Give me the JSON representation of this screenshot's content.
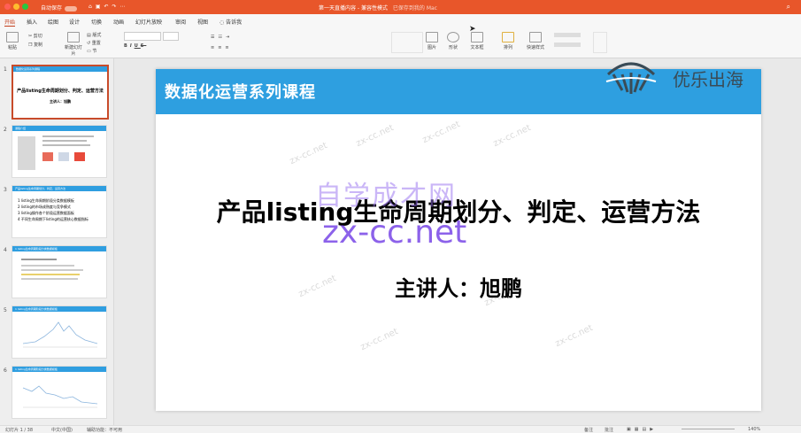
{
  "titlebar": {
    "autosave_label": "自动保存",
    "autosave_state": "off",
    "document_title": "第一天直播内容 - 兼容性模式",
    "document_subtitle": "已保存到我的 Mac"
  },
  "menu": {
    "tabs": [
      "开始",
      "插入",
      "绘图",
      "设计",
      "切换",
      "动画",
      "幻灯片放映",
      "审阅",
      "视图"
    ],
    "tell_me": "告诉我"
  },
  "ribbon": {
    "paste": "粘贴",
    "cut": "剪切",
    "copy": "复制",
    "new_slide": "新建幻灯片",
    "layout": "版式",
    "reset": "重置",
    "section": "节",
    "picture": "图片",
    "shape": "形状",
    "textbox": "文本框",
    "arrange": "排列",
    "quick_styles": "快速样式"
  },
  "slides_panel": {
    "thumbnails": [
      {
        "number": "1",
        "header": "数据化运营系列课程",
        "title": "产品listing生命周期划分、判定、运营方法",
        "speaker": "主讲人：旭鹏",
        "selected": true
      },
      {
        "number": "2",
        "header": "课程介绍",
        "selected": false
      },
      {
        "number": "3",
        "header": "产品listing生命周期划分、判定、运营方法",
        "lines": [
          "1 listing生命周期阶段分类数据模板",
          "2 listing的市场成熟度与竞争模式",
          "3 listing操作各个阶段运营数据面板",
          "4 不同生命周期下listing的运营核心数据指标"
        ],
        "selected": false
      },
      {
        "number": "4",
        "header": "1 listing生命周期阶段分类数据模板",
        "selected": false
      },
      {
        "number": "5",
        "header": "1 listing生命周期阶段分类数据模板",
        "selected": false
      },
      {
        "number": "6",
        "header": "1 listing生命周期阶段分类数据模板",
        "selected": false
      }
    ]
  },
  "slide": {
    "header": "数据化运营系列课程",
    "title": "产品listing生命周期划分、判定、运营方法",
    "speaker": "主讲人：旭鹏",
    "watermark_cn": "自学成才网",
    "watermark_url": "zx-cc.net",
    "watermark_small": "zx-cc.net",
    "logo_text": "优乐出海"
  },
  "statusbar": {
    "slide_count": "幻灯片 1 / 38",
    "language": "中文(中国)",
    "accessibility": "辅助功能：不可用",
    "notes": "备注",
    "comments": "批注",
    "zoom": "140%"
  }
}
